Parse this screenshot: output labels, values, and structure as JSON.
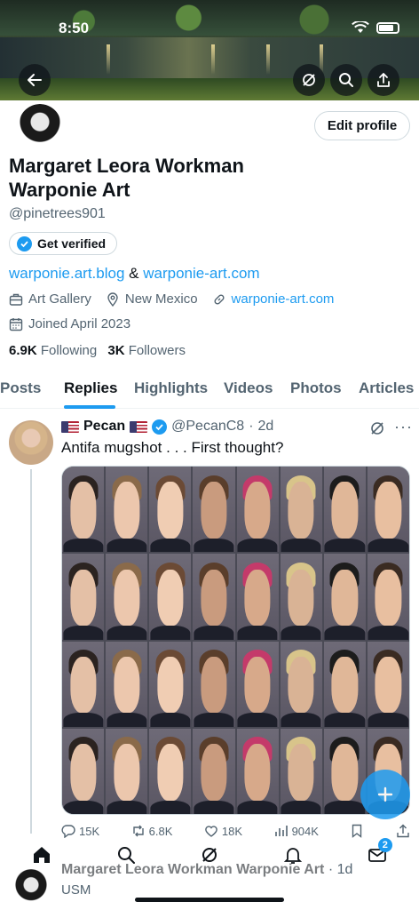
{
  "status_bar": {
    "time": "8:50"
  },
  "profile": {
    "name": "Margaret Leora Workman Warponie Art",
    "handle": "@pinetrees901",
    "edit_label": "Edit profile",
    "verified_label": "Get verified",
    "bio_link1": "warponie.art.blog",
    "bio_amp": "&",
    "bio_link2": "warponie-art.com",
    "category": "Art Gallery",
    "location": "New Mexico",
    "website": "warponie-art.com",
    "joined": "Joined April 2023",
    "following_count": "6.9K",
    "following_label": "Following",
    "followers_count": "3K",
    "followers_label": "Followers"
  },
  "tabs": [
    "Posts",
    "Replies",
    "Highlights",
    "Videos",
    "Photos",
    "Articles"
  ],
  "active_tab": "Replies",
  "tweet": {
    "author": "Pecan",
    "handle": "@PecanC8",
    "separator": "·",
    "time": "2d",
    "text": "Antifa mugshot . . . First thought?",
    "replies": "15K",
    "reposts": "6.8K",
    "likes": "18K",
    "views": "904K"
  },
  "bottom_nav": {
    "messages_badge": "2"
  },
  "next_post": {
    "author": "Margaret Leora Workman Warponie Art",
    "separator": "·",
    "time": "1d",
    "text": "USM"
  },
  "colors": {
    "accent": "#1d9bf0",
    "text": "#0f1419",
    "muted": "#536471"
  },
  "icons": [
    "back-arrow-icon",
    "grok-icon",
    "search-icon",
    "share-icon",
    "briefcase-icon",
    "location-icon",
    "link-icon",
    "calendar-icon",
    "reply-icon",
    "repost-icon",
    "like-icon",
    "views-icon",
    "bookmark-icon",
    "home-icon",
    "explore-icon",
    "notifications-icon",
    "messages-icon"
  ]
}
